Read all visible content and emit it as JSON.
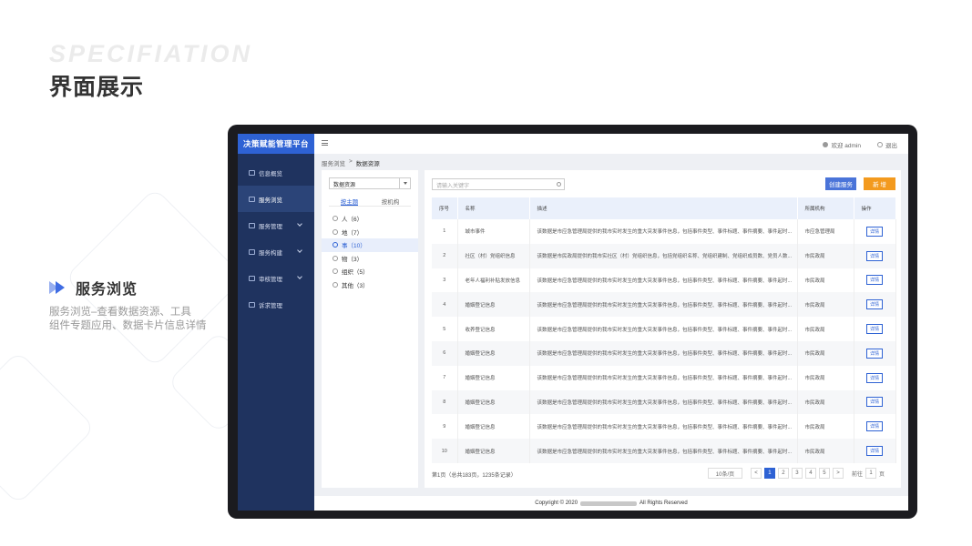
{
  "header": {
    "overlay": "SPECIFIATION",
    "title": "界面展示"
  },
  "section": {
    "title": "服务浏览",
    "desc_line1": "服务浏览–查看数据资源、工具",
    "desc_line2": "组件专题应用、数据卡片信息详情"
  },
  "app": {
    "logo": "决策赋能管理平台",
    "sidebar": [
      {
        "label": "信息概览",
        "active": false,
        "expand": false
      },
      {
        "label": "服务浏览",
        "active": true,
        "expand": false
      },
      {
        "label": "服务管理",
        "active": false,
        "expand": true
      },
      {
        "label": "服务构建",
        "active": false,
        "expand": true
      },
      {
        "label": "审核管理",
        "active": false,
        "expand": true
      },
      {
        "label": "诉求管理",
        "active": false,
        "expand": false
      }
    ],
    "topbar": {
      "welcome": "欢迎 admin",
      "logout": "退出"
    },
    "breadcrumb": {
      "parent": "服务浏览",
      "sep": ">",
      "current": "数据资源"
    },
    "tree": {
      "select_value": "数据资源",
      "tabs": [
        "按主题",
        "按机构"
      ],
      "items": [
        {
          "label": "人（6）",
          "active": false
        },
        {
          "label": "地（7）",
          "active": false
        },
        {
          "label": "事（10）",
          "active": true
        },
        {
          "label": "物（3）",
          "active": false
        },
        {
          "label": "组织（5）",
          "active": false
        },
        {
          "label": "其他（3）",
          "active": false
        }
      ]
    },
    "main": {
      "search_placeholder": "请输入关键字",
      "create_button": "创建服务",
      "orange_button": "新 增",
      "columns": [
        "序号",
        "名称",
        "描述",
        "所属机构",
        "操作"
      ],
      "rows": [
        {
          "no": "1",
          "name": "城市事件",
          "desc": "该数据是市应急管理局提供的我市实时发生的重大突发事件信息，包括事件类型、事件标题、事件摘要、事件起时...",
          "org": "市应急管理局",
          "op": "详情"
        },
        {
          "no": "2",
          "name": "社区（村）党组织信息",
          "desc": "该数据是市民政局提供的我市实社区（村）党组织信息，包括党组织名称、党组织建制、党组织成员数、党员人数...",
          "org": "市民政局",
          "op": "详情"
        },
        {
          "no": "3",
          "name": "老年人福利补贴发放信息",
          "desc": "该数据是市应急管理局提供的我市实时发生的重大突发事件信息，包括事件类型、事件标题、事件摘要、事件起时...",
          "org": "市民政局",
          "op": "详情"
        },
        {
          "no": "4",
          "name": "婚姻登记信息",
          "desc": "该数据是市应急管理局提供的我市实时发生的重大突发事件信息，包括事件类型、事件标题、事件摘要、事件起时...",
          "org": "市民政局",
          "op": "详情"
        },
        {
          "no": "5",
          "name": "收养登记信息",
          "desc": "该数据是市应急管理局提供的我市实时发生的重大突发事件信息，包括事件类型、事件标题、事件摘要、事件起时...",
          "org": "市民政局",
          "op": "详情"
        },
        {
          "no": "6",
          "name": "婚姻登记信息",
          "desc": "该数据是市应急管理局提供的我市实时发生的重大突发事件信息，包括事件类型、事件标题、事件摘要、事件起时...",
          "org": "市民政局",
          "op": "详情"
        },
        {
          "no": "7",
          "name": "婚姻登记信息",
          "desc": "该数据是市应急管理局提供的我市实时发生的重大突发事件信息，包括事件类型、事件标题、事件摘要、事件起时...",
          "org": "市民政局",
          "op": "详情"
        },
        {
          "no": "8",
          "name": "婚姻登记信息",
          "desc": "该数据是市应急管理局提供的我市实时发生的重大突发事件信息，包括事件类型、事件标题、事件摘要、事件起时...",
          "org": "市民政局",
          "op": "详情"
        },
        {
          "no": "9",
          "name": "婚姻登记信息",
          "desc": "该数据是市应急管理局提供的我市实时发生的重大突发事件信息，包括事件类型、事件标题、事件摘要、事件起时...",
          "org": "市民政局",
          "op": "详情"
        },
        {
          "no": "10",
          "name": "婚姻登记信息",
          "desc": "该数据是市应急管理局提供的我市实时发生的重大突发事件信息，包括事件类型、事件标题、事件摘要、事件起时...",
          "org": "市民政局",
          "op": "详情"
        }
      ],
      "summary": "第1页（总共183页，1235条记录）",
      "pager": {
        "page_size": "10条/页",
        "prev": "<",
        "next": ">",
        "pages": [
          "1",
          "2",
          "3",
          "4",
          "5"
        ],
        "current": "1",
        "goto_label": "前往",
        "goto_value": "1",
        "page_unit": "页"
      }
    },
    "footer": {
      "left": "Copyright © 2020",
      "right": "All Rights Reserved"
    }
  },
  "colors": {
    "accent": "#2e62d4",
    "sidebar": "#1f335f",
    "orange": "#f39a1e",
    "create": "#4a74d9"
  }
}
